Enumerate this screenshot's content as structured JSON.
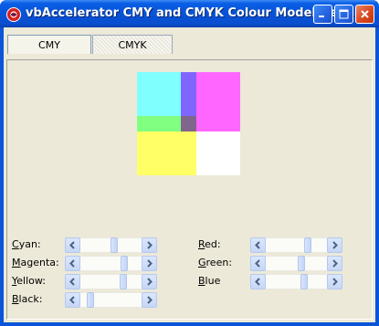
{
  "window": {
    "title": "vbAccelerator CMY and CMYK Colour Model Dem...",
    "buttons": [
      "minimize",
      "maximize",
      "close"
    ]
  },
  "tabs": [
    {
      "label": "CMY",
      "selected": false
    },
    {
      "label": "CMYK",
      "selected": true
    }
  ],
  "colors": {
    "cyan_block": "#80ffff",
    "magenta_block": "#ff66ff",
    "cyan_magenta_overlap": "#8066ff",
    "green_strip": "#80ff80",
    "overlap_dark": "#80668c",
    "yellow_block": "#ffff66",
    "white_block": "#ffffff"
  },
  "sliders_cmyk": [
    {
      "name": "cyan",
      "label_accel": "C",
      "label_rest": "yan:",
      "value_fraction": 0.56
    },
    {
      "name": "magenta",
      "label_accel": "M",
      "label_rest": "agenta:",
      "value_fraction": 0.75
    },
    {
      "name": "yellow",
      "label_accel": "Y",
      "label_rest": "ellow:",
      "value_fraction": 0.73
    },
    {
      "name": "black",
      "label_accel": "B",
      "label_rest": "lack:",
      "value_fraction": 0.12
    }
  ],
  "sliders_rgb": [
    {
      "name": "red",
      "label_accel": "R",
      "label_rest": "ed:",
      "value_fraction": 0.72
    },
    {
      "name": "green",
      "label_accel": "G",
      "label_rest": "reen:",
      "value_fraction": 0.6
    },
    {
      "name": "blue",
      "label_accel": "B",
      "label_rest": "lue",
      "value_fraction": 0.64
    }
  ]
}
